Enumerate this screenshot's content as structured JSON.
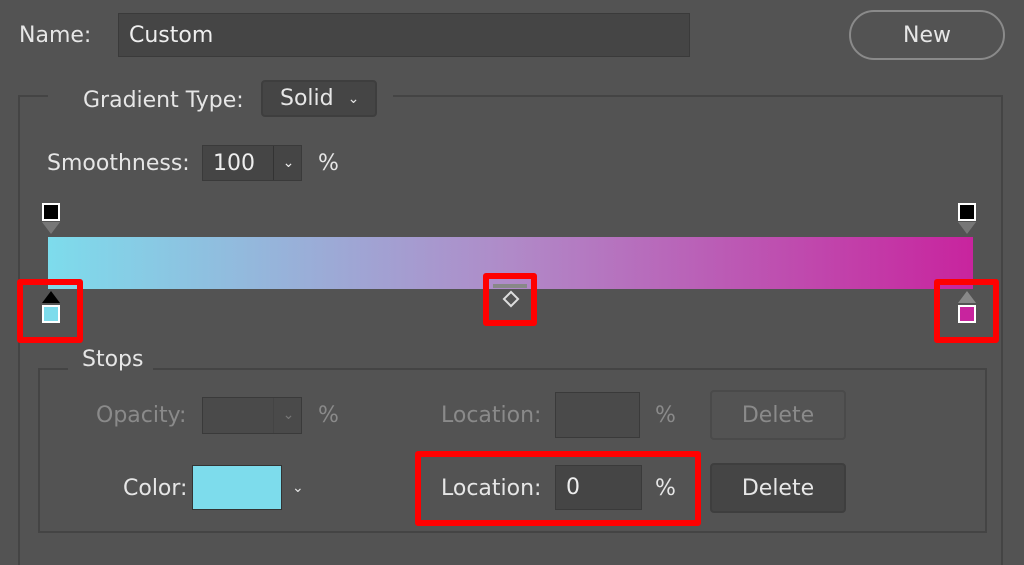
{
  "name": {
    "label": "Name:",
    "value": "Custom"
  },
  "new_button": "New",
  "gradient_type": {
    "label": "Gradient Type:",
    "value": "Solid"
  },
  "smoothness": {
    "label": "Smoothness:",
    "value": "100",
    "unit": "%"
  },
  "gradient": {
    "start_color": "#7ddcec",
    "mid_color": "#b08ac8",
    "end_color": "#c8249e"
  },
  "stops": {
    "title": "Stops",
    "opacity": {
      "label": "Opacity:",
      "value": "",
      "unit": "%",
      "location_label": "Location:",
      "location_value": "",
      "location_unit": "%",
      "delete": "Delete"
    },
    "color": {
      "label": "Color:",
      "swatch": "#7ddcec",
      "location_label": "Location:",
      "location_value": "0",
      "location_unit": "%",
      "delete": "Delete"
    }
  },
  "highlight_color": "#ff0000"
}
